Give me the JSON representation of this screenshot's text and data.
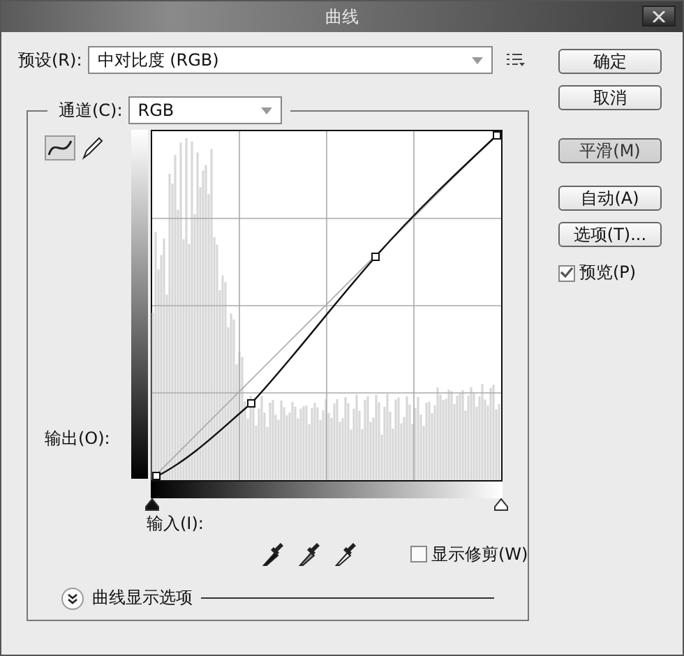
{
  "window": {
    "title": "曲线"
  },
  "preset": {
    "label": "预设(R):",
    "value": "中对比度 (RGB)"
  },
  "channel": {
    "label": "通道(C):",
    "value": "RGB"
  },
  "output_label": "输出(O):",
  "input_sliders": [
    {
      "level": 0
    },
    {
      "level": 1
    }
  ],
  "input_label": "输入(I):",
  "show_clipping": {
    "label": "显示修剪(W)",
    "checked": false
  },
  "display_options": {
    "label": "曲线显示选项"
  },
  "buttons": [
    {
      "label": "确定",
      "disabled": false
    },
    {
      "label": "取消",
      "disabled": false
    },
    {
      "label": "平滑(M)",
      "disabled": true
    },
    {
      "label": "自动(A)",
      "disabled": false
    },
    {
      "label": "选项(T)...",
      "disabled": false
    }
  ],
  "preview": {
    "label": "预览(P)",
    "checked": true
  }
}
